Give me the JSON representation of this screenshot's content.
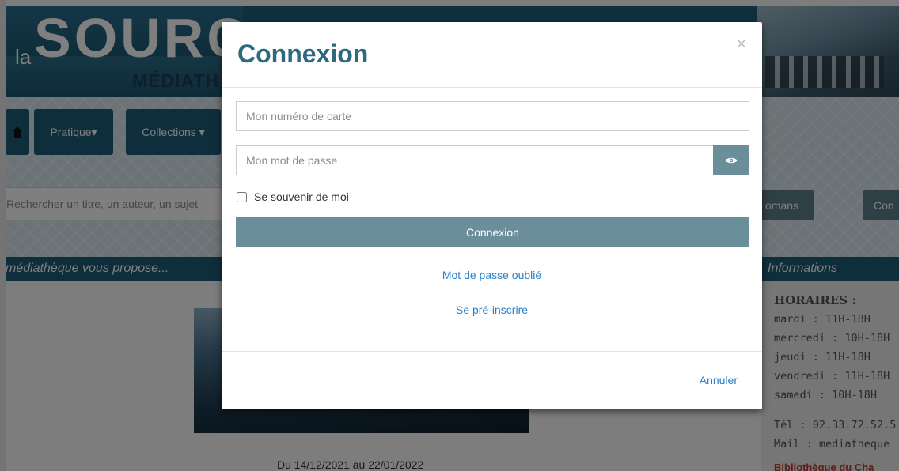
{
  "background": {
    "logo": {
      "la": "la",
      "source": "SOURC",
      "mediatheque": "MÉDIATH"
    },
    "nav": {
      "pratique": "Pratique▾",
      "collections": "Collections ▾"
    },
    "search_placeholder": "Rechercher un titre, un auteur, un sujet",
    "tags": {
      "romans": "omans",
      "con": "Con"
    },
    "section_left": "médiathèque vous propose...",
    "section_right": "Informations",
    "hours": {
      "title": "HORAIRES :",
      "lines": [
        "mardi : 11H-18H",
        "mercredi : 10H-18H",
        "jeudi : 11H-18H",
        "vendredi : 11H-18H",
        "samedi : 10H-18H"
      ]
    },
    "contact": {
      "tel": "Tél : 02.33.72.52.5",
      "mail": "Mail : mediatheque"
    },
    "bibliotheque_link": "Bibliothèque du Cha",
    "event_date": "Du 14/12/2021 au 22/01/2022"
  },
  "modal": {
    "title": "Connexion",
    "close": "×",
    "card_placeholder": "Mon numéro de carte",
    "card_value": "",
    "password_placeholder": "Mon mot de passe",
    "password_value": "",
    "remember_label": "Se souvenir de moi",
    "remember_checked": false,
    "login_button": "Connexion",
    "forgot_link": "Mot de passe oublié",
    "preregister_link": "Se pré-inscrire",
    "cancel_link": "Annuler",
    "accent_color": "#6b8e9b",
    "link_color": "#2a80c8"
  }
}
